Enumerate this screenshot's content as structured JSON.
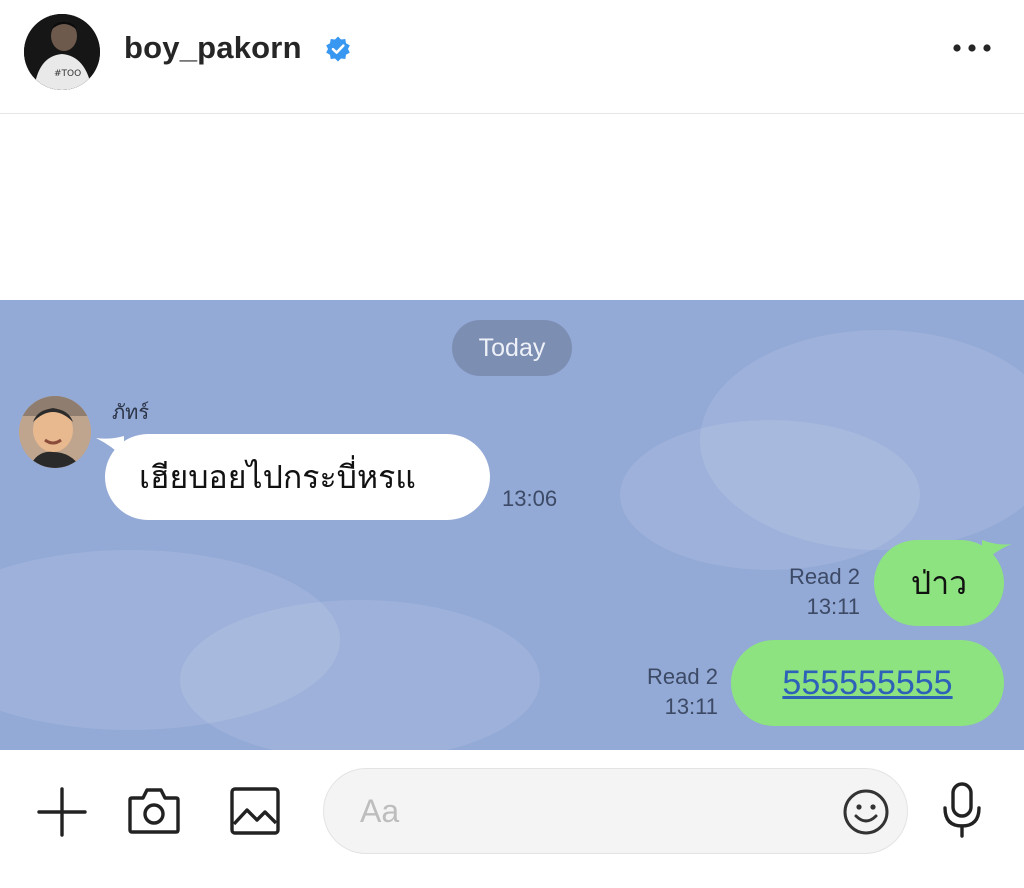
{
  "post": {
    "username": "boy_pakorn",
    "verified": true,
    "icons": {
      "verified": "verified-badge-icon",
      "more": "more-options-icon"
    },
    "colors": {
      "verified": "#3897f0",
      "text": "#262626"
    }
  },
  "chat": {
    "background_color": "#93a9d6",
    "date_divider": "Today",
    "messages": [
      {
        "direction": "incoming",
        "sender": "ภัทร์",
        "text": "เฮียบอยไปกระบี่หรแ",
        "time": "13:06"
      },
      {
        "direction": "outgoing",
        "text": "ป่าว",
        "read": "Read 2",
        "time": "13:11"
      },
      {
        "direction": "outgoing",
        "text": "555555555",
        "read": "Read 2",
        "time": "13:11",
        "is_link": true
      }
    ],
    "colors": {
      "incoming_bubble": "#ffffff",
      "outgoing_bubble": "#8de380",
      "link": "#2e62b8"
    }
  },
  "input_bar": {
    "placeholder": "Aa",
    "icons": [
      "plus-icon",
      "camera-icon",
      "image-icon",
      "emoji-icon",
      "microphone-icon"
    ]
  }
}
